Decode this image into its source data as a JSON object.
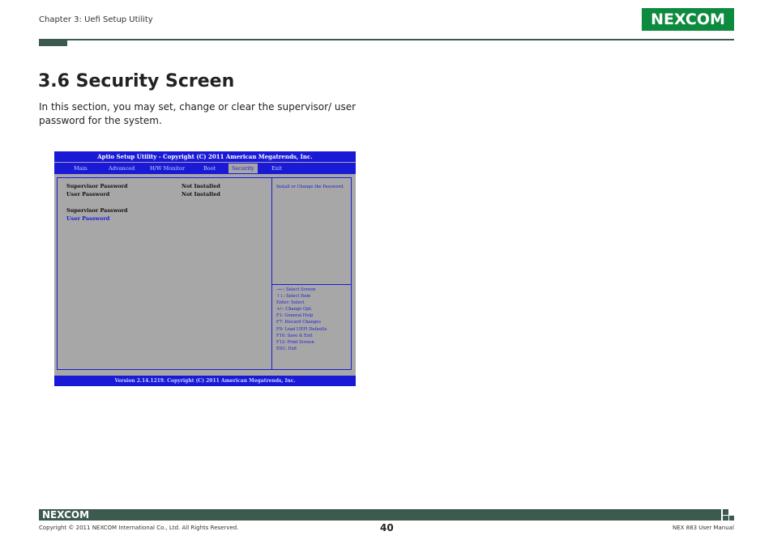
{
  "header": {
    "chapter": "Chapter 3: Uefi Setup Utility",
    "logo": "NEXCOM"
  },
  "section": {
    "title": "3.6 Security Screen",
    "intro": "In this section, you may set, change or clear the supervisor/ user password for the system."
  },
  "bios": {
    "title": "Aptio Setup Utility - Copyright (C) 2011 American Megatrends, Inc.",
    "tabs": [
      {
        "label": "Main",
        "active": false
      },
      {
        "label": "Advanced",
        "active": false
      },
      {
        "label": "H/W Monitor",
        "active": false
      },
      {
        "label": "Boot",
        "active": false
      },
      {
        "label": "Security",
        "active": true
      },
      {
        "label": "Exit",
        "active": false
      }
    ],
    "status": [
      {
        "label": "Supervisor Password",
        "value": "Not Installed"
      },
      {
        "label": "User Password",
        "value": "Not Installed"
      }
    ],
    "options": [
      {
        "label": "Supervisor Password",
        "selected": false
      },
      {
        "label": "User Password",
        "selected": true
      }
    ],
    "help_text": "Install or Change the Password.",
    "keys": [
      "→←: Select Screen",
      "↑↓: Select Item",
      "Enter: Select",
      "+/-: Change Opt.",
      "F1: General Help",
      "F7: Discard Changes",
      "F9: Load UEFI Defaults",
      "F10: Save & Exit",
      "F12: Print Screen",
      "ESC: Exit"
    ],
    "footer": "Version 2.14.1219. Copyright (C) 2011 American Megatrends, Inc."
  },
  "footer": {
    "logo": "NEXCOM",
    "copyright": "Copyright © 2011 NEXCOM International Co., Ltd. All Rights Reserved.",
    "page_number": "40",
    "manual": "NEX 883 User Manual"
  },
  "colors": {
    "brand_green": "#0c8a3e",
    "rule": "#3d5a4f",
    "bios_blue": "#1a1ad6",
    "bios_gray": "#a7a7a7"
  }
}
